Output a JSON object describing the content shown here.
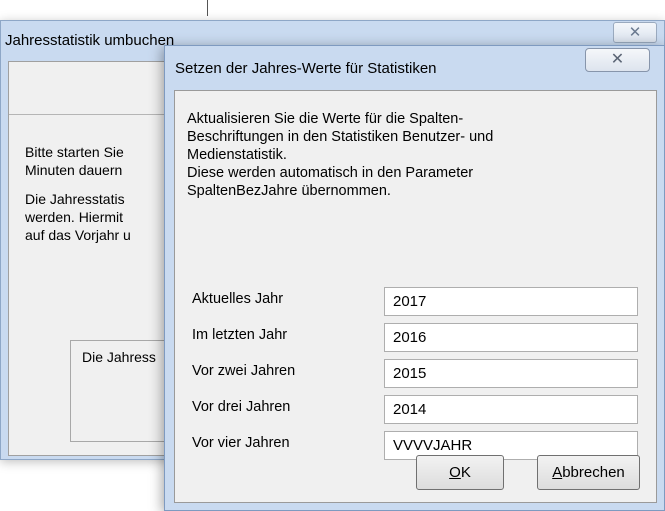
{
  "background_dialog": {
    "title": "Jahresstatistik umbuchen",
    "close_glyph": "✕",
    "text1": "Bitte starten Sie\nMinuten dauern",
    "text2": "Die Jahresstatis\nwerden. Hiermit\nauf das Vorjahr u",
    "group_label": "Die Jahress"
  },
  "dialog": {
    "title": "Setzen der Jahres-Werte für Statistiken",
    "close_glyph": "✕",
    "description": "Aktualisieren Sie die Werte für die Spalten-\nBeschriftungen in den Statistiken Benutzer- und\nMedienstatistik.\nDiese werden automatisch in den Parameter\nSpaltenBezJahre übernommen.",
    "fields": [
      {
        "label": "Aktuelles Jahr",
        "value": "2017"
      },
      {
        "label": "Im letzten Jahr",
        "value": "2016"
      },
      {
        "label": "Vor zwei Jahren",
        "value": "2015"
      },
      {
        "label": "Vor drei Jahren",
        "value": "2014"
      },
      {
        "label": "Vor vier Jahren",
        "value": "VVVVJAHR"
      }
    ],
    "ok": {
      "underlined": "O",
      "rest": "K"
    },
    "cancel": {
      "underlined": "A",
      "rest": "bbrechen"
    }
  }
}
